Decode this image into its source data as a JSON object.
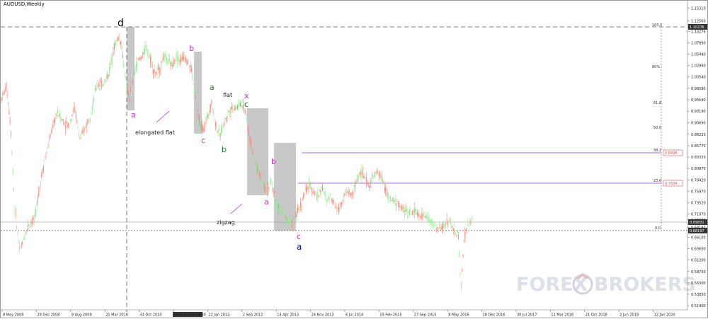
{
  "symbol_label": "AUDUSD,Weekly",
  "colors": {
    "background": "#ffffff",
    "bull_candle": "#90ee90",
    "bear_candle": "#fa8072",
    "magenta_label": "#cc33cc",
    "green_label": "#1f7a1f",
    "navy_label": "#0a0a8a",
    "fib_line": "#9932cc",
    "fib_vertical": "#e05050",
    "highlight_box": "#c8c8c8",
    "watermark": "#d9dde6"
  },
  "chart_data": {
    "type": "candlestick",
    "symbol": "AUDUSD",
    "timeframe": "Weekly",
    "ylim": [
      0.5127,
      1.16
    ],
    "y_ticks": [
      "1.15310",
      "1.12560",
      "1.10276",
      "1.07890",
      "1.05440",
      "1.02990",
      "1.00540",
      "0.98090",
      "0.95640",
      "0.93190",
      "0.90690",
      "0.88220",
      "0.85770",
      "0.83320",
      "0.80870",
      "0.78420",
      "0.75970",
      "0.73520",
      "0.71070",
      "0.69831",
      "0.68197",
      "0.66100",
      "0.63650",
      "0.61200",
      "0.58750",
      "0.56300",
      "0.53850",
      "0.51400"
    ],
    "x_ticks": [
      "8 May 2008",
      "28 Dec 2008",
      "9 Aug 2009",
      "21 Mar 2010",
      "31 Oct 2010",
      "2011.07.31 00:00",
      "22 Jan 2012",
      "2 Sep 2012",
      "14 Apr 2013",
      "24 Nov 2013",
      "6 Jul 2014",
      "15 Feb 2015",
      "27 Sep 2015",
      "8 May 2016",
      "18 Dec 2016",
      "30 Jul 2017",
      "11 Mar 2018",
      "21 Oct 2018",
      "2 Jun 2019",
      "12 Jan 2020"
    ],
    "price_path": [
      [
        0,
        0.955
      ],
      [
        8,
        0.985
      ],
      [
        14,
        0.9
      ],
      [
        20,
        0.72
      ],
      [
        27,
        0.63
      ],
      [
        33,
        0.66
      ],
      [
        40,
        0.69
      ],
      [
        48,
        0.7
      ],
      [
        56,
        0.78
      ],
      [
        64,
        0.84
      ],
      [
        72,
        0.89
      ],
      [
        80,
        0.93
      ],
      [
        88,
        0.91
      ],
      [
        96,
        0.9
      ],
      [
        104,
        0.94
      ],
      [
        112,
        0.87
      ],
      [
        120,
        0.9
      ],
      [
        128,
        0.93
      ],
      [
        136,
        0.99
      ],
      [
        144,
        0.99
      ],
      [
        152,
        1.01
      ],
      [
        160,
        1.07
      ],
      [
        166,
        1.09
      ],
      [
        170,
        1.08
      ],
      [
        174,
        1.03
      ],
      [
        178,
        0.98
      ],
      [
        182,
        0.96
      ],
      [
        188,
        1.01
      ],
      [
        194,
        1.04
      ],
      [
        200,
        1.05
      ],
      [
        206,
        1.07
      ],
      [
        212,
        1.04
      ],
      [
        218,
        1.01
      ],
      [
        224,
        1.02
      ],
      [
        230,
        1.05
      ],
      [
        236,
        1.04
      ],
      [
        242,
        1.03
      ],
      [
        248,
        1.05
      ],
      [
        254,
        1.04
      ],
      [
        260,
        1.05
      ],
      [
        266,
        1.03
      ],
      [
        270,
        1.02
      ],
      [
        274,
        0.97
      ],
      [
        280,
        0.91
      ],
      [
        286,
        0.89
      ],
      [
        292,
        0.92
      ],
      [
        298,
        0.95
      ],
      [
        304,
        0.9
      ],
      [
        310,
        0.88
      ],
      [
        316,
        0.91
      ],
      [
        322,
        0.93
      ],
      [
        328,
        0.94
      ],
      [
        334,
        0.94
      ],
      [
        340,
        0.95
      ],
      [
        346,
        0.93
      ],
      [
        352,
        0.87
      ],
      [
        358,
        0.83
      ],
      [
        364,
        0.8
      ],
      [
        370,
        0.78
      ],
      [
        376,
        0.76
      ],
      [
        382,
        0.78
      ],
      [
        388,
        0.74
      ],
      [
        394,
        0.72
      ],
      [
        400,
        0.71
      ],
      [
        406,
        0.7
      ],
      [
        412,
        0.69
      ],
      [
        418,
        0.71
      ],
      [
        424,
        0.73
      ],
      [
        430,
        0.76
      ],
      [
        436,
        0.77
      ],
      [
        442,
        0.76
      ],
      [
        448,
        0.75
      ],
      [
        454,
        0.77
      ],
      [
        460,
        0.74
      ],
      [
        466,
        0.75
      ],
      [
        472,
        0.73
      ],
      [
        478,
        0.72
      ],
      [
        484,
        0.75
      ],
      [
        490,
        0.76
      ],
      [
        496,
        0.75
      ],
      [
        502,
        0.78
      ],
      [
        508,
        0.8
      ],
      [
        514,
        0.79
      ],
      [
        520,
        0.77
      ],
      [
        526,
        0.79
      ],
      [
        532,
        0.8
      ],
      [
        538,
        0.79
      ],
      [
        544,
        0.76
      ],
      [
        550,
        0.74
      ],
      [
        556,
        0.74
      ],
      [
        562,
        0.73
      ],
      [
        568,
        0.72
      ],
      [
        574,
        0.72
      ],
      [
        580,
        0.71
      ],
      [
        586,
        0.72
      ],
      [
        592,
        0.7
      ],
      [
        598,
        0.71
      ],
      [
        604,
        0.7
      ],
      [
        610,
        0.69
      ],
      [
        616,
        0.68
      ],
      [
        622,
        0.68
      ],
      [
        628,
        0.69
      ],
      [
        634,
        0.7
      ],
      [
        640,
        0.67
      ],
      [
        646,
        0.67
      ],
      [
        650,
        0.55
      ],
      [
        654,
        0.65
      ],
      [
        658,
        0.68
      ],
      [
        662,
        0.69
      ],
      [
        666,
        0.7
      ]
    ]
  },
  "wave_labels": [
    {
      "text": "d",
      "color": "black"
    },
    {
      "text": "a",
      "color": "magenta"
    },
    {
      "text": "b",
      "color": "magenta"
    },
    {
      "text": "c",
      "color": "magenta"
    },
    {
      "text": "a",
      "color": "green"
    },
    {
      "text": "b",
      "color": "green"
    },
    {
      "text": "c",
      "color": "green"
    },
    {
      "text": "x",
      "color": "magenta"
    },
    {
      "text": "b",
      "color": "magenta"
    },
    {
      "text": "a",
      "color": "magenta"
    },
    {
      "text": "c",
      "color": "magenta"
    },
    {
      "text": "a",
      "color": "navy"
    }
  ],
  "annotations": {
    "elongated_flat": "elongated flat",
    "flat": "flat",
    "zigzag": "zigzag"
  },
  "fib_levels": [
    {
      "label": "100.0"
    },
    {
      "label": "80%"
    },
    {
      "label": "61.8"
    },
    {
      "label": "50.0"
    },
    {
      "label": "38.2",
      "price_box": "0.8498"
    },
    {
      "label": "23.6",
      "price_box": "0.7834"
    },
    {
      "label": "0.0"
    }
  ],
  "price_boxes": {
    "top": "1.10276",
    "current": "0.69831",
    "dotted": "0.68197"
  },
  "watermark": {
    "left": "FOREX",
    "right": "BROKERS"
  }
}
